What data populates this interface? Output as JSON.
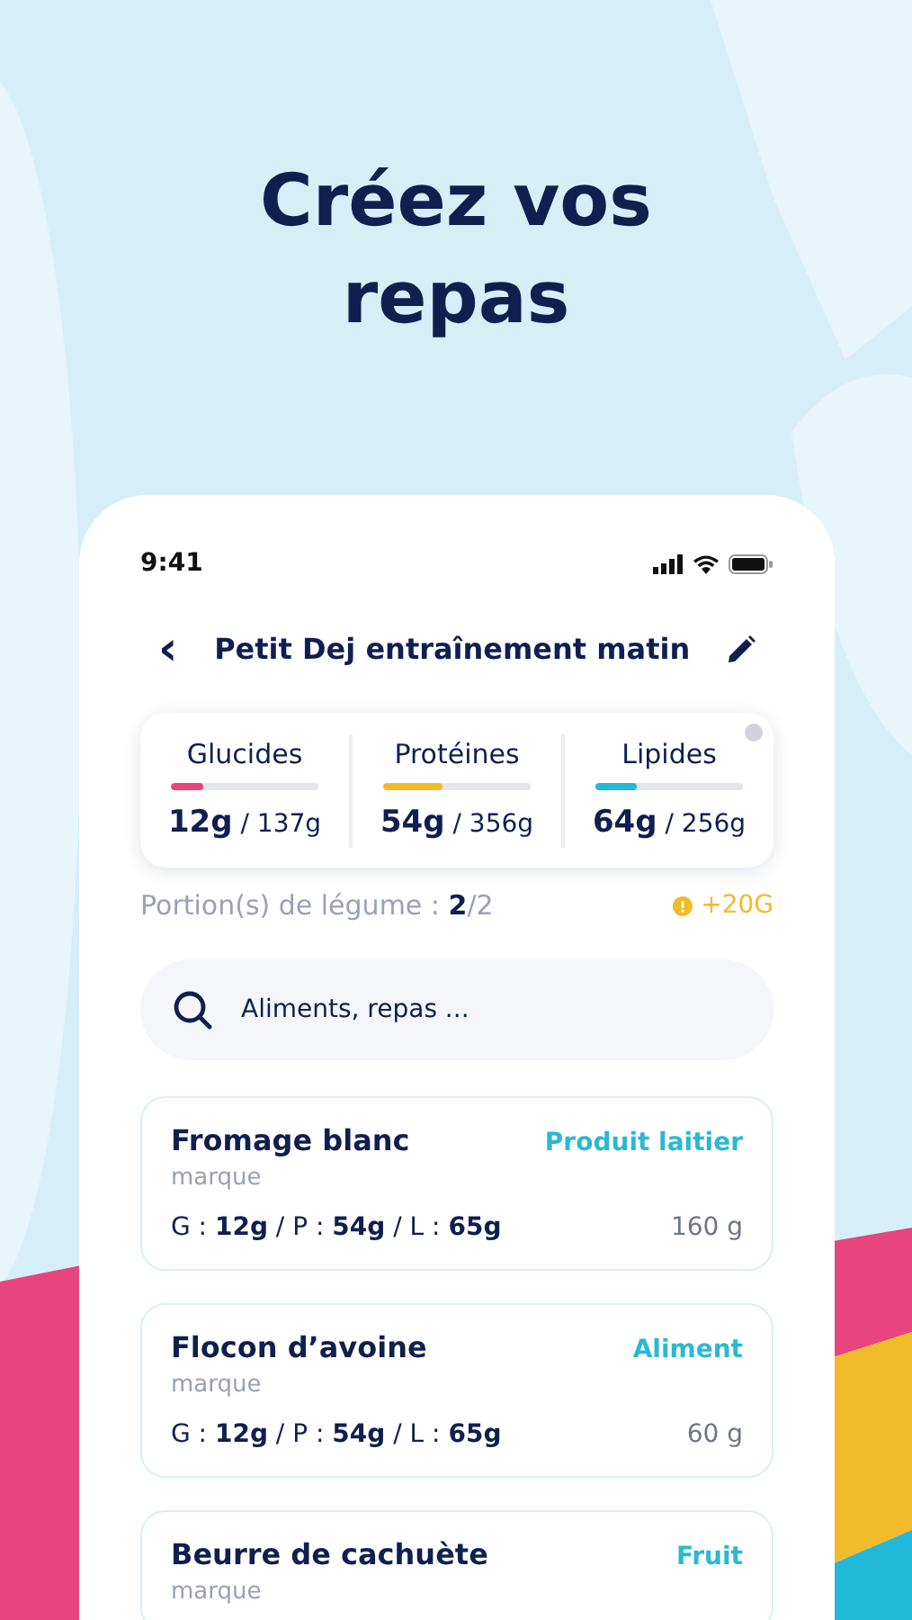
{
  "headline": "Créez vos repas",
  "status_bar": {
    "time": "9:41"
  },
  "header": {
    "back": "‹",
    "title": "Petit Dej entraînement matin"
  },
  "macros": [
    {
      "name": "Glucides",
      "level": 0.22,
      "color": "#e8457f",
      "amount": "**12g** / 137g"
    },
    {
      "name": "Protéines",
      "level": 0.4,
      "color": "#f2bb2c",
      "amount": "**54g** / 356g"
    },
    {
      "name": "Lipides",
      "level": 0.28,
      "color": "#22b8d8",
      "amount": "**64g** / 256g"
    }
  ],
  "vegetables": {
    "label": "Portion(s) de légume : **2**/2",
    "bonus": "+20G"
  },
  "search": {
    "placeholder": "Aliments, repas ..."
  },
  "foods": [
    {
      "name": "Fromage blanc",
      "brand": "marque",
      "category": "Produit laitier",
      "macros": "G : **12g** / P : **54g** / L : **65g**",
      "weight": "160 g"
    },
    {
      "name": "Flocon d’avoine",
      "brand": "marque",
      "category": "Aliment",
      "macros": "G : **12g** / P : **54g** / L : **65g**",
      "weight": "60 g"
    },
    {
      "name": "Beurre de cachuète",
      "brand": "marque",
      "category": "Fruit"
    }
  ]
}
